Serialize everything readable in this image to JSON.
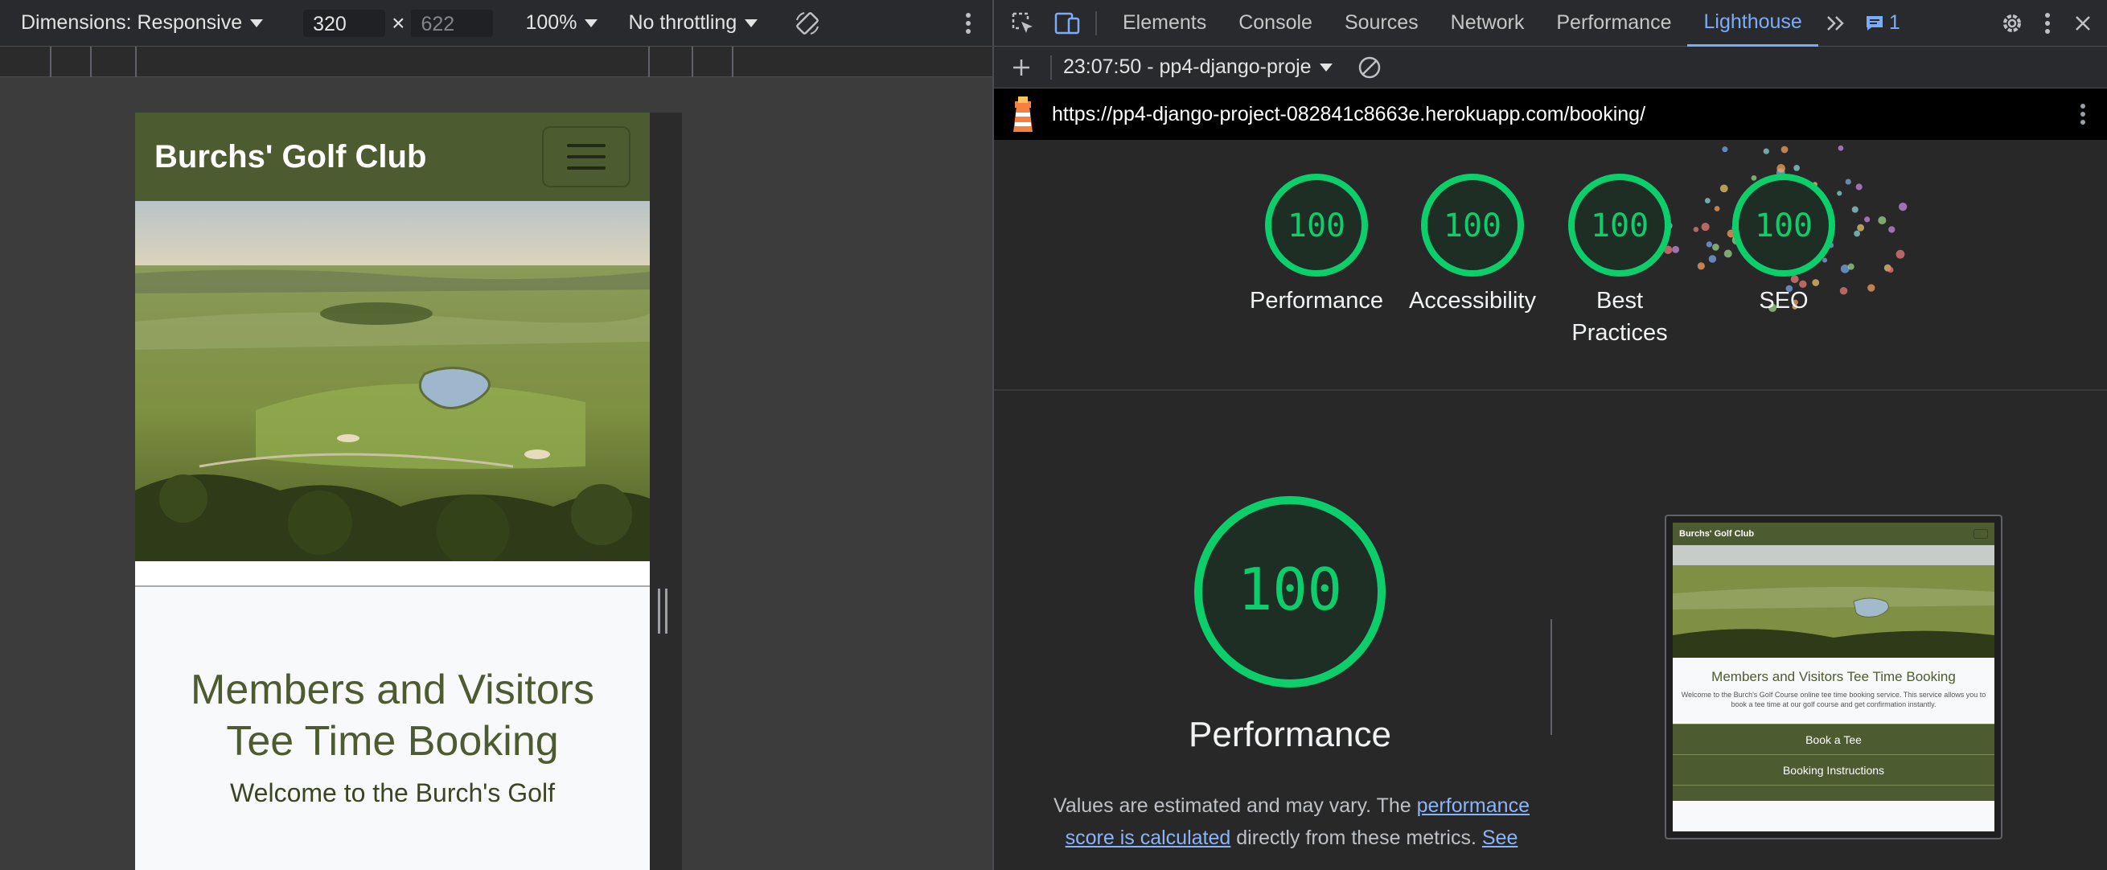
{
  "device_toolbar": {
    "dimensions_label": "Dimensions: Responsive",
    "width_value": "320",
    "times": "×",
    "height_placeholder": "622",
    "zoom": "100%",
    "throttling": "No throttling"
  },
  "website": {
    "brand": "Burchs' Golf Club",
    "heading": "Members and Visitors Tee Time Booking",
    "welcome_partial": "Welcome to the Burch's Golf"
  },
  "devtools": {
    "tabs": [
      "Elements",
      "Console",
      "Sources",
      "Network",
      "Performance",
      "Lighthouse"
    ],
    "active_tab": "Lighthouse",
    "issues_count": "1",
    "report_selector": "23:07:50 - pp4-django-proje",
    "url": "https://pp4-django-project-082841c8663e.herokuapp.com/booking/"
  },
  "scores": [
    {
      "label": "Performance",
      "value": "100"
    },
    {
      "label": "Accessibility",
      "value": "100"
    },
    {
      "label": "Best Practices",
      "value": "100"
    },
    {
      "label": "SEO",
      "value": "100"
    }
  ],
  "performance_section": {
    "score": "100",
    "title": "Performance",
    "desc_1": "Values are estimated and may vary. The ",
    "link_1": "performance score is calculated",
    "desc_2": " directly from these metrics. ",
    "link_2": "See"
  },
  "thumbnail": {
    "brand": "Burchs' Golf Club",
    "title": "Members and Visitors Tee Time Booking",
    "subtitle": "Welcome to the Burch's Golf Course online tee time booking service. This service allows you to book a tee time at our golf course and get confirmation instantly.",
    "button_1": "Book a Tee",
    "button_2": "Booking Instructions"
  },
  "colors": {
    "gauge_green": "#0cce6b",
    "brand_olive": "#4d5b30",
    "devtools_accent": "#7cacf8"
  }
}
